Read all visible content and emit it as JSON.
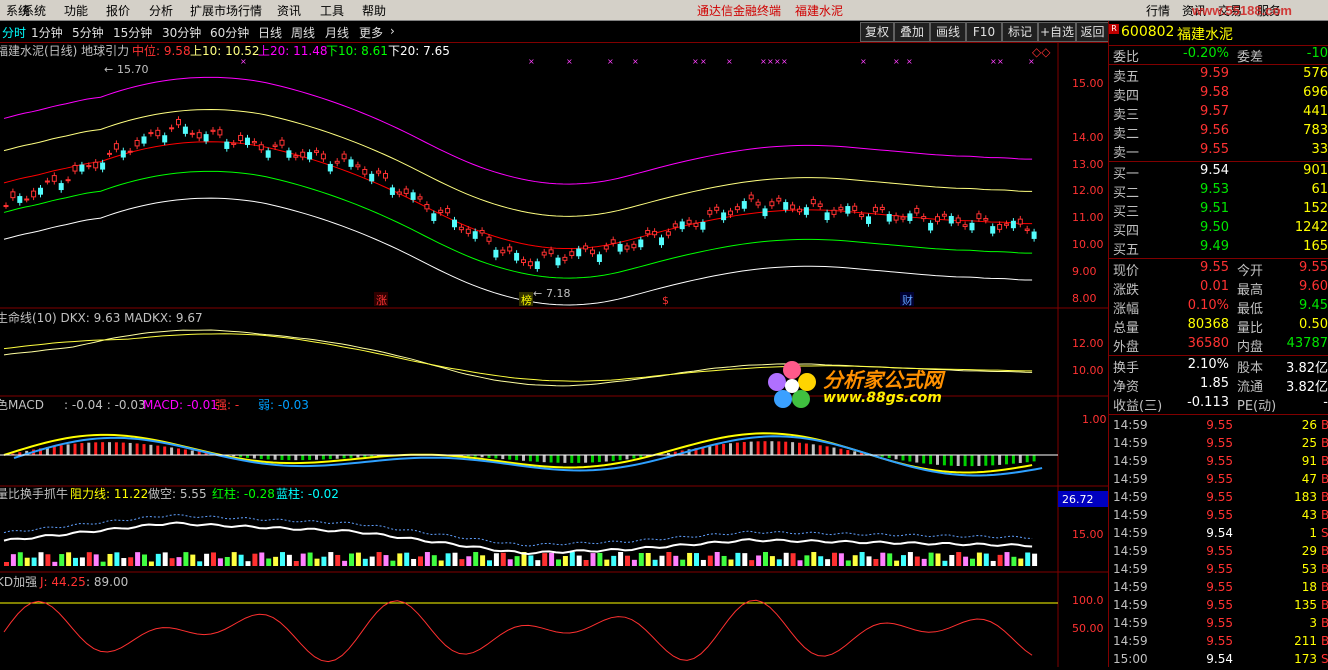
{
  "menu": {
    "items": [
      "系统",
      "功能",
      "报价",
      "分析",
      "扩展市场行情",
      "资讯",
      "工具",
      "帮助"
    ],
    "promo1": "通达信金融终端",
    "promo2": "福建水泥",
    "right": [
      "行情",
      "资讯",
      "交易",
      "服务"
    ],
    "brand": "www.55188.com"
  },
  "periods": {
    "items": [
      "分时",
      "1分钟",
      "5分钟",
      "15分钟",
      "30分钟",
      "60分钟",
      "日线",
      "周线",
      "月线",
      "更多"
    ],
    "buttons": [
      "复权",
      "叠加",
      "画线",
      "F10",
      "标记",
      "+自选",
      "返回"
    ]
  },
  "panel_main": {
    "label_prefix": "福建水泥(日线) 地球引力",
    "mid_label": "中位: 9.58",
    "up10": "上10: 10.52",
    "up20": "上20: 11.48",
    "dn10": "下10: 8.61",
    "dn20": "下20: 7.65",
    "high_label": "15.70",
    "low_label": "7.18",
    "yticks": [
      "15.00",
      "14.00",
      "13.00",
      "12.00",
      "11.00",
      "10.00",
      "9.00",
      "8.00"
    ],
    "markers": [
      "涨",
      "榜",
      "$",
      "财"
    ]
  },
  "panel_dkx": {
    "label": "生命线(10) DKX: 9.63 MADKX: 9.67",
    "yticks": [
      "12.00",
      "10.00"
    ]
  },
  "panel_macd": {
    "label_a": "色MACD",
    "label_b": ": -0.04 : -0.03",
    "label_c": "MACD: -0.01",
    "label_d": "强: -",
    "label_e": "弱: -0.03",
    "ytick": "1.00"
  },
  "panel_vol": {
    "label_a": "量比换手抓牛",
    "label_b": "阻力线: 11.22",
    "label_c": "做空: 5.55",
    "label_d": "红柱: -0.28",
    "label_e": "蓝柱: -0.02",
    "ytick": "15.00",
    "cursor_value": "26.72"
  },
  "panel_kd": {
    "label_a": "KD加强",
    "label_b": "J: 44.25",
    "label_c": ": 89.00",
    "yticks": [
      "100.0",
      "50.00"
    ]
  },
  "quote": {
    "code": "600802",
    "name": "福建水泥",
    "weibi_label": "委比",
    "weibi": "-0.20%",
    "weicha_label": "委差",
    "weicha": "-10",
    "asks": [
      {
        "label": "卖五",
        "price": "9.59",
        "qty": "576"
      },
      {
        "label": "卖四",
        "price": "9.58",
        "qty": "696"
      },
      {
        "label": "卖三",
        "price": "9.57",
        "qty": "441"
      },
      {
        "label": "卖二",
        "price": "9.56",
        "qty": "783"
      },
      {
        "label": "卖一",
        "price": "9.55",
        "qty": "33"
      }
    ],
    "bids": [
      {
        "label": "买一",
        "price": "9.54",
        "qty": "901"
      },
      {
        "label": "买二",
        "price": "9.53",
        "qty": "61"
      },
      {
        "label": "买三",
        "price": "9.51",
        "qty": "152"
      },
      {
        "label": "买四",
        "price": "9.50",
        "qty": "1242"
      },
      {
        "label": "买五",
        "price": "9.49",
        "qty": "165"
      }
    ],
    "stats": [
      {
        "l1": "现价",
        "v1": "9.55",
        "l2": "今开",
        "v2": "9.55"
      },
      {
        "l1": "涨跌",
        "v1": "0.01",
        "l2": "最高",
        "v2": "9.60"
      },
      {
        "l1": "涨幅",
        "v1": "0.10%",
        "l2": "最低",
        "v2": "9.45"
      },
      {
        "l1": "总量",
        "v1": "80368",
        "l2": "量比",
        "v2": "0.50"
      },
      {
        "l1": "外盘",
        "v1": "36580",
        "l2": "内盘",
        "v2": "43787"
      }
    ],
    "stats2": [
      {
        "l1": "换手",
        "v1": "2.10%",
        "l2": "股本",
        "v2": "3.82亿"
      },
      {
        "l1": "净资",
        "v1": "1.85",
        "l2": "流通",
        "v2": "3.82亿"
      },
      {
        "l1": "收益(三)",
        "v1": "-0.113",
        "l2": "PE(动)",
        "v2": "-"
      }
    ],
    "ticks": [
      {
        "t": "14:59",
        "p": "9.55",
        "n": "26",
        "b": "B"
      },
      {
        "t": "14:59",
        "p": "9.55",
        "n": "25",
        "b": "B"
      },
      {
        "t": "14:59",
        "p": "9.55",
        "n": "91",
        "b": "B"
      },
      {
        "t": "14:59",
        "p": "9.55",
        "n": "47",
        "b": "B"
      },
      {
        "t": "14:59",
        "p": "9.55",
        "n": "183",
        "b": "B"
      },
      {
        "t": "14:59",
        "p": "9.55",
        "n": "43",
        "b": "B"
      },
      {
        "t": "14:59",
        "p": "9.54",
        "n": "1",
        "b": "S"
      },
      {
        "t": "14:59",
        "p": "9.55",
        "n": "29",
        "b": "B"
      },
      {
        "t": "14:59",
        "p": "9.55",
        "n": "53",
        "b": "B"
      },
      {
        "t": "14:59",
        "p": "9.55",
        "n": "18",
        "b": "B"
      },
      {
        "t": "14:59",
        "p": "9.55",
        "n": "135",
        "b": "B"
      },
      {
        "t": "14:59",
        "p": "9.55",
        "n": "3",
        "b": "B"
      },
      {
        "t": "14:59",
        "p": "9.55",
        "n": "211",
        "b": "B"
      },
      {
        "t": "15:00",
        "p": "9.54",
        "n": "173",
        "b": "S"
      }
    ]
  },
  "watermark": {
    "title": "分析家公式网",
    "url": "www.88gs.com"
  },
  "colors": {
    "up": "#ff3232",
    "down": "#54fcfc",
    "grid": "#800000",
    "mid": "#ff0000",
    "up10": "#ffff80",
    "up20": "#ff00ff",
    "dn10": "#00ff00",
    "dn20": "#ffffff"
  }
}
